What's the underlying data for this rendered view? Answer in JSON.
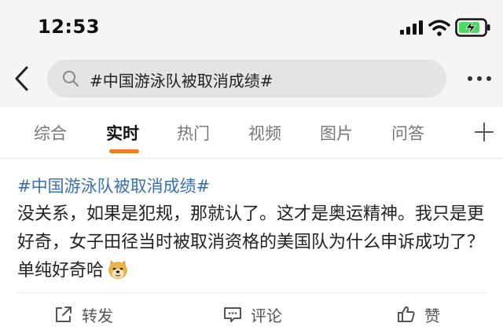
{
  "status_bar": {
    "time": "12:53",
    "icons": [
      "cellular-signal-icon",
      "wifi-icon",
      "battery-charging-icon"
    ]
  },
  "nav": {
    "back_icon": "chevron-left-icon",
    "search_icon": "search-icon",
    "search_text": "#中国游泳队被取消成绩#",
    "more_icon": "more-dots-icon"
  },
  "tabs": {
    "items": [
      {
        "label": "综合"
      },
      {
        "label": "实时"
      },
      {
        "label": "热门"
      },
      {
        "label": "视频"
      },
      {
        "label": "图片"
      },
      {
        "label": "问答"
      }
    ],
    "active_tab": "实时",
    "add_icon": "plus-icon"
  },
  "post": {
    "hashtag": "#中国游泳队被取消成绩#",
    "content": "没关系，如果是犯规，那就认了。这才是奥运精神。我只是更好奇，女子田径当时被取消资格的美国队为什么申诉成功了？单纯好奇哈",
    "emoji": "doge-emoji-icon"
  },
  "actions": {
    "repost_label": "转发",
    "comment_label": "评论",
    "like_label": "赞"
  },
  "colors": {
    "accent": "#f07d24",
    "hashtag": "#3a6fb0",
    "header_bg": "#f5f5f5"
  }
}
